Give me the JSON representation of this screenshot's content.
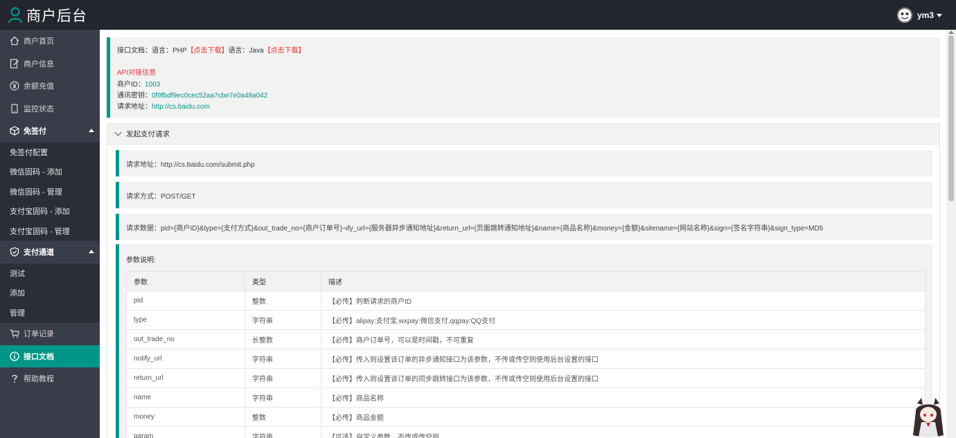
{
  "header": {
    "title": "商户后台",
    "username": "ym3"
  },
  "sidebar": {
    "top_items": [
      {
        "label": "商户首页",
        "icon": "home-icon"
      },
      {
        "label": "商户信息",
        "icon": "edit-icon"
      },
      {
        "label": "余额充值",
        "icon": "yen-icon"
      },
      {
        "label": "监控状态",
        "icon": "phone-icon"
      }
    ],
    "group1": {
      "label": "免签付",
      "icon": "cube-icon",
      "items": [
        "免签付配置",
        "微信固码 - 添加",
        "微信固码 - 管理",
        "支付宝固码 - 添加",
        "支付宝固码 - 管理"
      ]
    },
    "group2": {
      "label": "支付通道",
      "icon": "shield-icon",
      "items": [
        "测试",
        "添加",
        "管理"
      ]
    },
    "bottom_items": [
      {
        "label": "订单记录",
        "icon": "cart-icon"
      },
      {
        "label": "接口文档",
        "icon": "info-icon",
        "active": true
      },
      {
        "label": "帮助教程",
        "icon": "question-icon"
      }
    ]
  },
  "doc": {
    "lang_prefix1": "接口文档：语言：PHP",
    "download1": "【点击下载】",
    "lang_prefix2": "语言：Java",
    "download2": "【点击下载】",
    "api_title": "API对接信息",
    "merchant_id_label": "商户ID：",
    "merchant_id": "1003",
    "key_label": "通讯密钥：",
    "key": "0f9fbdf9ec0cec52aa7cbe7e0a48a042",
    "url_label": "请求地址：",
    "url": "http://cs.baidu.com"
  },
  "panel": {
    "title": "发起支付请求",
    "request_url": "请求地址：http://cs.baidu.com/submit.php",
    "request_method": "请求方式：POST/GET",
    "request_data": "请求数据：pid={商户ID}&type={支付方式}&out_trade_no={商户订单号}¬ify_url={服务器异步通知地址}&return_url={页面跳转通知地址}&name={商品名称}&money={金额}&sitename={网站名称}&sign={签名字符串}&sign_type=MD5",
    "params_title": "参数说明:",
    "columns": [
      "参数",
      "类型",
      "描述"
    ],
    "rows": [
      [
        "pid",
        "整数",
        "【必传】判断请求的商户ID"
      ],
      [
        "type",
        "字符串",
        "【必传】alipay:支付宝,wxpay:微信支付,qqpay:QQ支付"
      ],
      [
        "out_trade_no",
        "长整数",
        "【必传】商户订单号，可以是时间戳，不可重复"
      ],
      [
        "notify_url",
        "字符串",
        "【必传】传入则设置该订单的异步通知接口为该参数，不传或传空则使用后台设置的接口"
      ],
      [
        "return_url",
        "字符串",
        "【必传】传入则设置该订单的同步跳转接口为该参数，不传或传空则使用后台设置的接口"
      ],
      [
        "name",
        "字符串",
        "【必传】商品名称"
      ],
      [
        "money",
        "整数",
        "【必传】商品金额"
      ],
      [
        "param",
        "字符串",
        "【可选】自定义参数，不传或传空则"
      ]
    ]
  },
  "colors": {
    "accent": "#009688",
    "sidebar_bg": "#393d49",
    "header_bg": "#23262e",
    "link_red": "#e53935"
  }
}
